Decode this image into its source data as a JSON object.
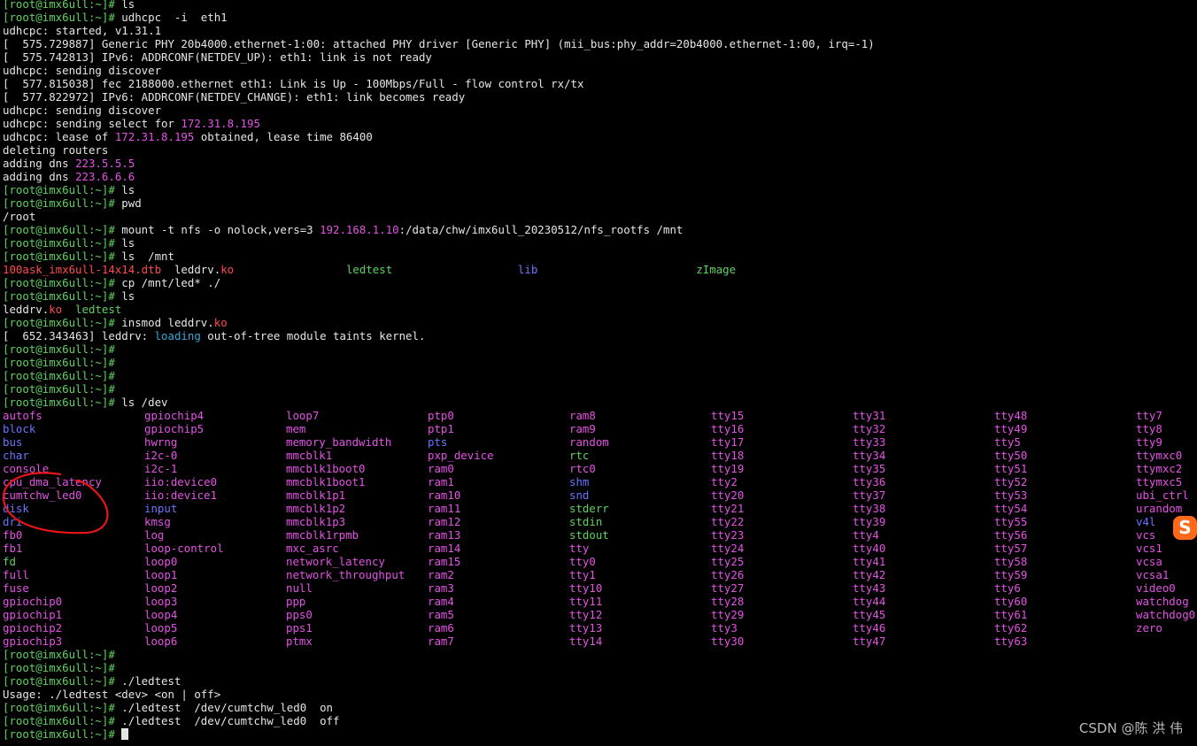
{
  "prompt": "[root@imx6ull:~]#",
  "lines": [
    [
      {
        "t": "[root@imx6ull:~]#",
        "c": "g"
      },
      {
        "t": " ls",
        "c": "w"
      }
    ],
    [
      {
        "t": "[root@imx6ull:~]#",
        "c": "g"
      },
      {
        "t": " udhcpc  -i  eth1",
        "c": "w"
      }
    ],
    [
      {
        "t": "udhcpc: started, v1.31.1",
        "c": "w"
      }
    ],
    [
      {
        "t": "[  575.729887] Generic PHY 20b4000.ethernet-1:00: attached PHY driver [Generic PHY] (mii_bus:phy_addr=20b4000.ethernet-1:00, irq=-1)",
        "c": "w"
      }
    ],
    [
      {
        "t": "[  575.742813] IPv6: ADDRCONF(NETDEV_UP): eth1: link is not ready",
        "c": "w"
      }
    ],
    [
      {
        "t": "udhcpc: sending discover",
        "c": "w"
      }
    ],
    [
      {
        "t": "[  577.815038] fec 2188000.ethernet eth1: Link is Up - 100Mbps/Full - flow control rx/tx",
        "c": "w"
      }
    ],
    [
      {
        "t": "[  577.822972] IPv6: ADDRCONF(NETDEV_CHANGE): eth1: link becomes ready",
        "c": "w"
      }
    ],
    [
      {
        "t": "udhcpc: sending discover",
        "c": "w"
      }
    ],
    [
      {
        "t": "udhcpc: sending select for ",
        "c": "w"
      },
      {
        "t": "172.31.8.195",
        "c": "m"
      }
    ],
    [
      {
        "t": "udhcpc: lease of ",
        "c": "w"
      },
      {
        "t": "172.31.8.195",
        "c": "m"
      },
      {
        "t": " obtained, lease time 86400",
        "c": "w"
      }
    ],
    [
      {
        "t": "deleting routers",
        "c": "w"
      }
    ],
    [
      {
        "t": "adding dns ",
        "c": "w"
      },
      {
        "t": "223.5.5.5",
        "c": "m"
      }
    ],
    [
      {
        "t": "adding dns ",
        "c": "w"
      },
      {
        "t": "223.6.6.6",
        "c": "m"
      }
    ],
    [
      {
        "t": "[root@imx6ull:~]#",
        "c": "g"
      },
      {
        "t": " ls",
        "c": "w"
      }
    ],
    [
      {
        "t": "[root@imx6ull:~]#",
        "c": "g"
      },
      {
        "t": " pwd",
        "c": "w"
      }
    ],
    [
      {
        "t": "/root",
        "c": "w"
      }
    ],
    [
      {
        "t": "[root@imx6ull:~]#",
        "c": "g"
      },
      {
        "t": " mount -t nfs -o nolock,vers=3 ",
        "c": "w"
      },
      {
        "t": "192.168.1.10",
        "c": "m"
      },
      {
        "t": ":/data/chw/imx6ull_20230512/nfs_rootfs /mnt",
        "c": "w"
      }
    ],
    [
      {
        "t": "[root@imx6ull:~]#",
        "c": "g"
      },
      {
        "t": " ls",
        "c": "w"
      }
    ],
    [
      {
        "t": "[root@imx6ull:~]#",
        "c": "g"
      },
      {
        "t": " ls  /mnt",
        "c": "w"
      }
    ],
    [
      {
        "t": "100ask_imx6ull-14x14.dtb",
        "c": "r"
      },
      {
        "t": "  leddrv.",
        "c": "w"
      },
      {
        "t": "ko",
        "c": "r"
      },
      {
        "t": "                 ",
        "c": "w"
      },
      {
        "t": "ledtest",
        "c": "g"
      },
      {
        "t": "                   ",
        "c": "w"
      },
      {
        "t": "lib",
        "c": "b"
      },
      {
        "t": "                        ",
        "c": "w"
      },
      {
        "t": "zImage",
        "c": "g"
      }
    ],
    [
      {
        "t": "[root@imx6ull:~]#",
        "c": "g"
      },
      {
        "t": " cp /mnt/led* ./",
        "c": "w"
      }
    ],
    [
      {
        "t": "[root@imx6ull:~]#",
        "c": "g"
      },
      {
        "t": " ls",
        "c": "w"
      }
    ],
    [
      {
        "t": "leddrv.",
        "c": "w"
      },
      {
        "t": "ko",
        "c": "r"
      },
      {
        "t": "  ledtest",
        "c": "g"
      }
    ],
    [
      {
        "t": "[root@imx6ull:~]#",
        "c": "g"
      },
      {
        "t": " insmod leddrv.",
        "c": "w"
      },
      {
        "t": "ko",
        "c": "r"
      }
    ],
    [
      {
        "t": "[  652.343463] leddrv: ",
        "c": "w"
      },
      {
        "t": "loading",
        "c": "c"
      },
      {
        "t": " out-of-tree module taints kernel.",
        "c": "w"
      }
    ],
    [
      {
        "t": "[root@imx6ull:~]#",
        "c": "g"
      }
    ],
    [
      {
        "t": "[root@imx6ull:~]#",
        "c": "g"
      }
    ],
    [
      {
        "t": "[root@imx6ull:~]#",
        "c": "g"
      }
    ],
    [
      {
        "t": "[root@imx6ull:~]#",
        "c": "g"
      }
    ],
    [
      {
        "t": "[root@imx6ull:~]#",
        "c": "g"
      },
      {
        "t": " ls /dev",
        "c": "w"
      }
    ]
  ],
  "dev_columns": [
    [
      {
        "t": "autofs",
        "c": "m"
      },
      {
        "t": "block",
        "c": "b"
      },
      {
        "t": "bus",
        "c": "b"
      },
      {
        "t": "char",
        "c": "b"
      },
      {
        "t": "console",
        "c": "m"
      },
      {
        "t": "cpu_dma_latency",
        "c": "m"
      },
      {
        "t": "cumtchw_led0",
        "c": "m"
      },
      {
        "t": "disk",
        "c": "b"
      },
      {
        "t": "dri",
        "c": "b"
      },
      {
        "t": "fb0",
        "c": "m"
      },
      {
        "t": "fb1",
        "c": "m"
      },
      {
        "t": "fd",
        "c": "g"
      },
      {
        "t": "full",
        "c": "m"
      },
      {
        "t": "fuse",
        "c": "m"
      },
      {
        "t": "gpiochip0",
        "c": "m"
      },
      {
        "t": "gpiochip1",
        "c": "m"
      },
      {
        "t": "gpiochip2",
        "c": "m"
      },
      {
        "t": "gpiochip3",
        "c": "m"
      }
    ],
    [
      {
        "t": "gpiochip4",
        "c": "m"
      },
      {
        "t": "gpiochip5",
        "c": "m"
      },
      {
        "t": "hwrng",
        "c": "m"
      },
      {
        "t": "i2c-0",
        "c": "m"
      },
      {
        "t": "i2c-1",
        "c": "m"
      },
      {
        "t": "iio:device0",
        "c": "m"
      },
      {
        "t": "iio:device1",
        "c": "m"
      },
      {
        "t": "input",
        "c": "b"
      },
      {
        "t": "kmsg",
        "c": "m"
      },
      {
        "t": "log",
        "c": "m"
      },
      {
        "t": "loop-control",
        "c": "m"
      },
      {
        "t": "loop0",
        "c": "m"
      },
      {
        "t": "loop1",
        "c": "m"
      },
      {
        "t": "loop2",
        "c": "m"
      },
      {
        "t": "loop3",
        "c": "m"
      },
      {
        "t": "loop4",
        "c": "m"
      },
      {
        "t": "loop5",
        "c": "m"
      },
      {
        "t": "loop6",
        "c": "m"
      }
    ],
    [
      {
        "t": "loop7",
        "c": "m"
      },
      {
        "t": "mem",
        "c": "m"
      },
      {
        "t": "memory_bandwidth",
        "c": "m"
      },
      {
        "t": "mmcblk1",
        "c": "m"
      },
      {
        "t": "mmcblk1boot0",
        "c": "m"
      },
      {
        "t": "mmcblk1boot1",
        "c": "m"
      },
      {
        "t": "mmcblk1p1",
        "c": "m"
      },
      {
        "t": "mmcblk1p2",
        "c": "m"
      },
      {
        "t": "mmcblk1p3",
        "c": "m"
      },
      {
        "t": "mmcblk1rpmb",
        "c": "m"
      },
      {
        "t": "mxc_asrc",
        "c": "m"
      },
      {
        "t": "network_latency",
        "c": "m"
      },
      {
        "t": "network_throughput",
        "c": "m"
      },
      {
        "t": "null",
        "c": "m"
      },
      {
        "t": "ppp",
        "c": "m"
      },
      {
        "t": "pps0",
        "c": "m"
      },
      {
        "t": "pps1",
        "c": "m"
      },
      {
        "t": "ptmx",
        "c": "m"
      }
    ],
    [
      {
        "t": "ptp0",
        "c": "m"
      },
      {
        "t": "ptp1",
        "c": "m"
      },
      {
        "t": "pts",
        "c": "b"
      },
      {
        "t": "pxp_device",
        "c": "m"
      },
      {
        "t": "ram0",
        "c": "m"
      },
      {
        "t": "ram1",
        "c": "m"
      },
      {
        "t": "ram10",
        "c": "m"
      },
      {
        "t": "ram11",
        "c": "m"
      },
      {
        "t": "ram12",
        "c": "m"
      },
      {
        "t": "ram13",
        "c": "m"
      },
      {
        "t": "ram14",
        "c": "m"
      },
      {
        "t": "ram15",
        "c": "m"
      },
      {
        "t": "ram2",
        "c": "m"
      },
      {
        "t": "ram3",
        "c": "m"
      },
      {
        "t": "ram4",
        "c": "m"
      },
      {
        "t": "ram5",
        "c": "m"
      },
      {
        "t": "ram6",
        "c": "m"
      },
      {
        "t": "ram7",
        "c": "m"
      }
    ],
    [
      {
        "t": "ram8",
        "c": "m"
      },
      {
        "t": "ram9",
        "c": "m"
      },
      {
        "t": "random",
        "c": "m"
      },
      {
        "t": "rtc",
        "c": "g"
      },
      {
        "t": "rtc0",
        "c": "m"
      },
      {
        "t": "shm",
        "c": "b"
      },
      {
        "t": "snd",
        "c": "b"
      },
      {
        "t": "stderr",
        "c": "g"
      },
      {
        "t": "stdin",
        "c": "g"
      },
      {
        "t": "stdout",
        "c": "g"
      },
      {
        "t": "tty",
        "c": "m"
      },
      {
        "t": "tty0",
        "c": "m"
      },
      {
        "t": "tty1",
        "c": "m"
      },
      {
        "t": "tty10",
        "c": "m"
      },
      {
        "t": "tty11",
        "c": "m"
      },
      {
        "t": "tty12",
        "c": "m"
      },
      {
        "t": "tty13",
        "c": "m"
      },
      {
        "t": "tty14",
        "c": "m"
      }
    ],
    [
      {
        "t": "tty15",
        "c": "m"
      },
      {
        "t": "tty16",
        "c": "m"
      },
      {
        "t": "tty17",
        "c": "m"
      },
      {
        "t": "tty18",
        "c": "m"
      },
      {
        "t": "tty19",
        "c": "m"
      },
      {
        "t": "tty2",
        "c": "m"
      },
      {
        "t": "tty20",
        "c": "m"
      },
      {
        "t": "tty21",
        "c": "m"
      },
      {
        "t": "tty22",
        "c": "m"
      },
      {
        "t": "tty23",
        "c": "m"
      },
      {
        "t": "tty24",
        "c": "m"
      },
      {
        "t": "tty25",
        "c": "m"
      },
      {
        "t": "tty26",
        "c": "m"
      },
      {
        "t": "tty27",
        "c": "m"
      },
      {
        "t": "tty28",
        "c": "m"
      },
      {
        "t": "tty29",
        "c": "m"
      },
      {
        "t": "tty3",
        "c": "m"
      },
      {
        "t": "tty30",
        "c": "m"
      }
    ],
    [
      {
        "t": "tty31",
        "c": "m"
      },
      {
        "t": "tty32",
        "c": "m"
      },
      {
        "t": "tty33",
        "c": "m"
      },
      {
        "t": "tty34",
        "c": "m"
      },
      {
        "t": "tty35",
        "c": "m"
      },
      {
        "t": "tty36",
        "c": "m"
      },
      {
        "t": "tty37",
        "c": "m"
      },
      {
        "t": "tty38",
        "c": "m"
      },
      {
        "t": "tty39",
        "c": "m"
      },
      {
        "t": "tty4",
        "c": "m"
      },
      {
        "t": "tty40",
        "c": "m"
      },
      {
        "t": "tty41",
        "c": "m"
      },
      {
        "t": "tty42",
        "c": "m"
      },
      {
        "t": "tty43",
        "c": "m"
      },
      {
        "t": "tty44",
        "c": "m"
      },
      {
        "t": "tty45",
        "c": "m"
      },
      {
        "t": "tty46",
        "c": "m"
      },
      {
        "t": "tty47",
        "c": "m"
      }
    ],
    [
      {
        "t": "tty48",
        "c": "m"
      },
      {
        "t": "tty49",
        "c": "m"
      },
      {
        "t": "tty5",
        "c": "m"
      },
      {
        "t": "tty50",
        "c": "m"
      },
      {
        "t": "tty51",
        "c": "m"
      },
      {
        "t": "tty52",
        "c": "m"
      },
      {
        "t": "tty53",
        "c": "m"
      },
      {
        "t": "tty54",
        "c": "m"
      },
      {
        "t": "tty55",
        "c": "m"
      },
      {
        "t": "tty56",
        "c": "m"
      },
      {
        "t": "tty57",
        "c": "m"
      },
      {
        "t": "tty58",
        "c": "m"
      },
      {
        "t": "tty59",
        "c": "m"
      },
      {
        "t": "tty6",
        "c": "m"
      },
      {
        "t": "tty60",
        "c": "m"
      },
      {
        "t": "tty61",
        "c": "m"
      },
      {
        "t": "tty62",
        "c": "m"
      },
      {
        "t": "tty63",
        "c": "m"
      }
    ],
    [
      {
        "t": "tty7",
        "c": "m"
      },
      {
        "t": "tty8",
        "c": "m"
      },
      {
        "t": "tty9",
        "c": "m"
      },
      {
        "t": "ttymxc0",
        "c": "m"
      },
      {
        "t": "ttymxc2",
        "c": "m"
      },
      {
        "t": "ttymxc5",
        "c": "m"
      },
      {
        "t": "ubi_ctrl",
        "c": "m"
      },
      {
        "t": "urandom",
        "c": "m"
      },
      {
        "t": "v4l",
        "c": "b"
      },
      {
        "t": "vcs",
        "c": "m"
      },
      {
        "t": "vcs1",
        "c": "m"
      },
      {
        "t": "vcsa",
        "c": "m"
      },
      {
        "t": "vcsa1",
        "c": "m"
      },
      {
        "t": "video0",
        "c": "m"
      },
      {
        "t": "watchdog",
        "c": "m"
      },
      {
        "t": "watchdog0",
        "c": "m"
      },
      {
        "t": "zero",
        "c": "m"
      }
    ]
  ],
  "tail_lines": [
    [
      {
        "t": "[root@imx6ull:~]#",
        "c": "g"
      }
    ],
    [
      {
        "t": "[root@imx6ull:~]#",
        "c": "g"
      }
    ],
    [
      {
        "t": "[root@imx6ull:~]#",
        "c": "g"
      },
      {
        "t": " ./ledtest",
        "c": "w"
      }
    ],
    [
      {
        "t": "Usage: ./ledtest <dev> <on | off>",
        "c": "w"
      }
    ],
    [
      {
        "t": "[root@imx6ull:~]#",
        "c": "g"
      },
      {
        "t": " ./ledtest  /dev/cumtchw_led0  on",
        "c": "w"
      }
    ],
    [
      {
        "t": "[root@imx6ull:~]#",
        "c": "g"
      },
      {
        "t": " ./ledtest  /dev/cumtchw_led0  off",
        "c": "w"
      }
    ]
  ],
  "watermark": "CSDN @陈 洪 伟",
  "ime_badge": "S",
  "annotation_color": "#e8151b"
}
